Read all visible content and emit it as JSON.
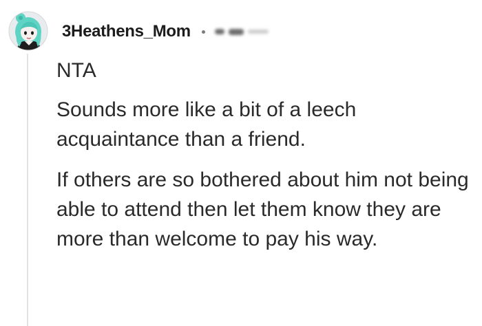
{
  "comment": {
    "author": "3Heathens_Mom",
    "paragraphs": [
      "NTA",
      "Sounds more like a bit of a leech acquaintance than a friend.",
      "If others are so bothered about him not being able to attend then let them know they are more than welcome to pay his way."
    ]
  },
  "icons": {
    "avatar": "avatar-icon"
  },
  "colors": {
    "text": "#1c1c1c",
    "body_text": "#2a2a2a",
    "avatar_accent": "#5fd3c4",
    "thread_line": "#e3e3e3"
  }
}
